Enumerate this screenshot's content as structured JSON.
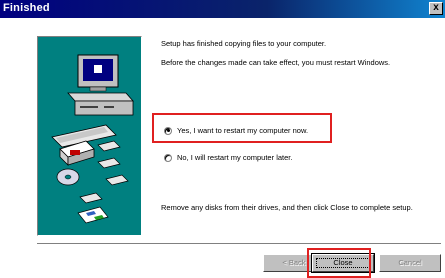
{
  "window": {
    "title": "Finished",
    "close_glyph": "x"
  },
  "content": {
    "line1": "Setup has finished copying files to your computer.",
    "line2": "Before the changes made can take effect, you must restart Windows.",
    "line3": "Remove any disks from their drives, and then click Close to complete setup."
  },
  "options": [
    {
      "label": "Yes, I want to restart my computer now.",
      "selected": true
    },
    {
      "label": "No, I will restart my computer later.",
      "selected": false
    }
  ],
  "buttons": {
    "back": "< Back",
    "close": "Close",
    "cancel": "Cancel"
  },
  "colors": {
    "bitmap_bg": "#008080",
    "highlight": "#e02020",
    "title_bar": "#000080"
  }
}
